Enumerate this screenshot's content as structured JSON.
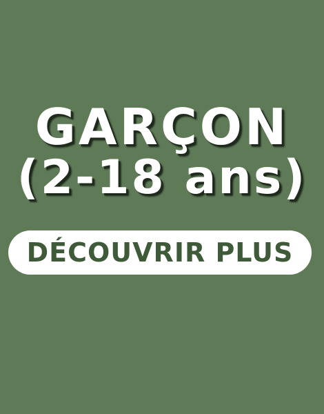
{
  "banner": {
    "title_line_1": "GARÇON",
    "title_line_2": "(2-18 ans)",
    "cta_label": "DÉCOUVRIR PLUS"
  },
  "colors": {
    "background": "#5f7a57",
    "title_text": "#ffffff",
    "title_shadow": "#1e2a1c",
    "cta_background": "#ffffff",
    "cta_text": "#3f5a38"
  }
}
